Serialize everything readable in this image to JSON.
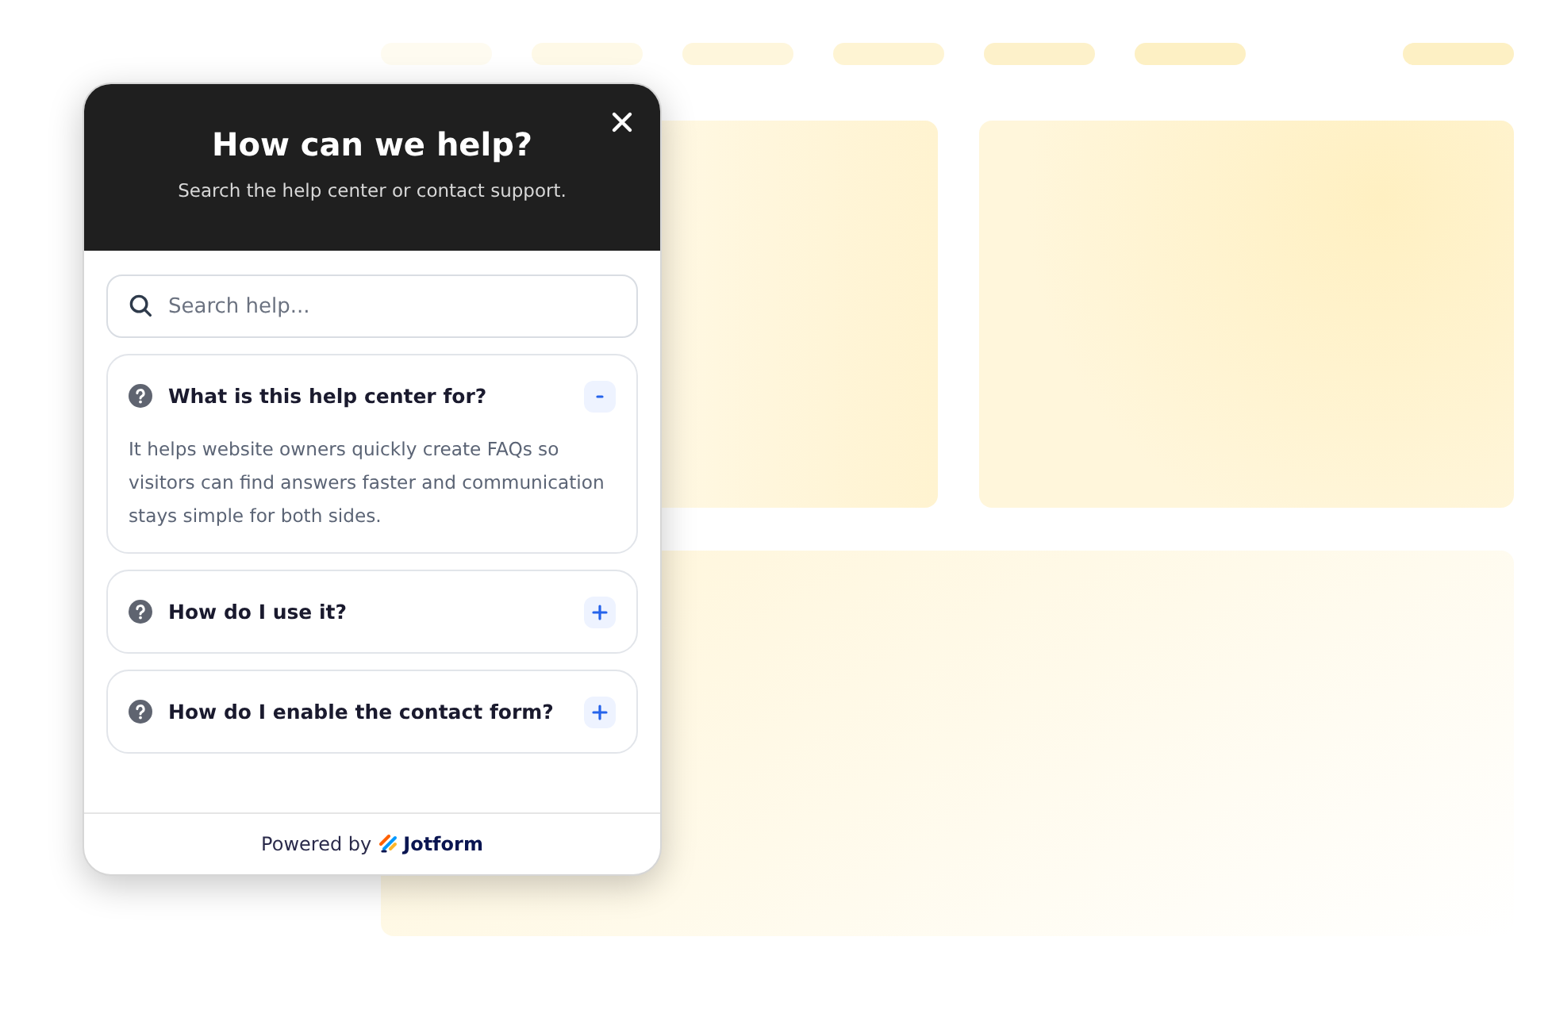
{
  "header": {
    "title": "How can we help?",
    "subtitle": "Search the help center or contact support."
  },
  "search": {
    "placeholder": "Search help..."
  },
  "faqs": [
    {
      "question": "What is this help center for?",
      "expanded": true,
      "answer": "It helps website owners quickly create FAQs so visitors can find answers faster and communication stays simple for both sides."
    },
    {
      "question": "How do I use it?",
      "expanded": false
    },
    {
      "question": "How do I enable the contact form?",
      "expanded": false
    }
  ],
  "footer": {
    "prefix": "Powered by",
    "brand": "Jotform"
  }
}
